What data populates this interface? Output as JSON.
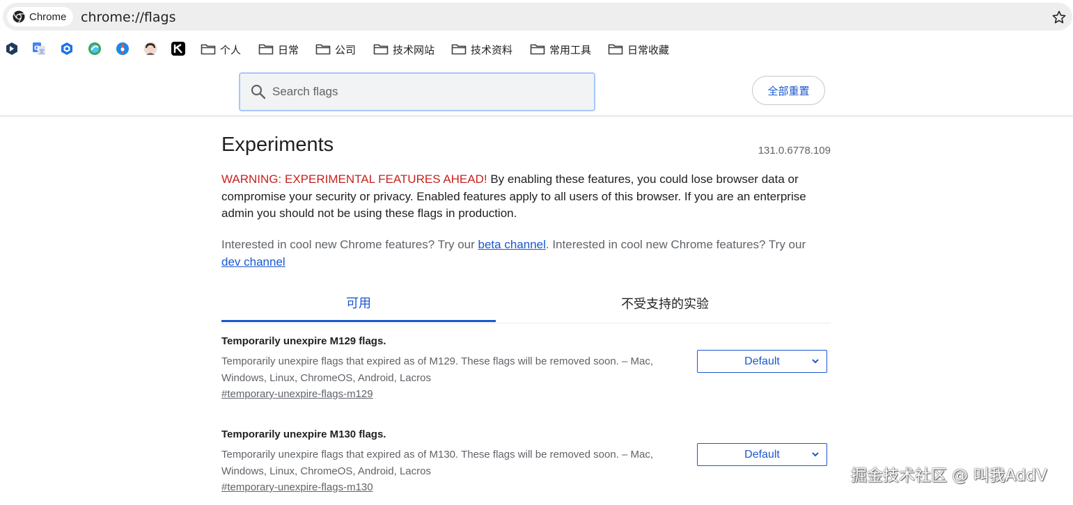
{
  "omnibox": {
    "chip_label": "Chrome",
    "url": "chrome://flags",
    "star_icon": "star-outline-icon"
  },
  "bookmarks": {
    "icons": [
      {
        "name": "bookmark-app-1-icon",
        "color": "#1f3a5c"
      },
      {
        "name": "google-translate-icon",
        "color": "#4285f4"
      },
      {
        "name": "bookmark-app-3-icon",
        "color": "#1a73e8"
      },
      {
        "name": "bookmark-app-4-icon",
        "color": "#34a853"
      },
      {
        "name": "bookmark-app-5-icon",
        "color": "#1e88e5"
      },
      {
        "name": "avatar-bookmark-icon",
        "color": "#7b5e57"
      },
      {
        "name": "bookmark-app-7-icon",
        "color": "#000000"
      }
    ],
    "folders": [
      "个人",
      "日常",
      "公司",
      "技术网站",
      "技术资料",
      "常用工具",
      "日常收藏"
    ]
  },
  "header": {
    "search_placeholder": "Search flags",
    "reset_label": "全部重置"
  },
  "main": {
    "title": "Experiments",
    "version": "131.0.6778.109",
    "warning_red": "WARNING: EXPERIMENTAL FEATURES AHEAD!",
    "warning_text": " By enabling these features, you could lose browser data or compromise your security or privacy. Enabled features apply to all users of this browser. If you are an enterprise admin you should not be using these flags in production.",
    "interest_text_1": "Interested in cool new Chrome features? Try our ",
    "beta_link": "beta channel",
    "interest_text_2": ". Interested in cool new Chrome features? Try our ",
    "dev_link": "dev channel",
    "tabs": {
      "available": "可用",
      "unavailable": "不受支持的实验"
    },
    "flags": [
      {
        "name": "Temporarily unexpire M129 flags.",
        "description": "Temporarily unexpire flags that expired as of M129. These flags will be removed soon. – Mac, Windows, Linux, ChromeOS, Android, Lacros",
        "link": "#temporary-unexpire-flags-m129",
        "value": "Default"
      },
      {
        "name": "Temporarily unexpire M130 flags.",
        "description": "Temporarily unexpire flags that expired as of M130. These flags will be removed soon. – Mac, Windows, Linux, ChromeOS, Android, Lacros",
        "link": "#temporary-unexpire-flags-m130",
        "value": "Default"
      }
    ]
  },
  "watermark": "掘金技术社区 @ 叫我AddV",
  "colors": {
    "accent": "#1a57d0",
    "warning": "#c5221f",
    "muted": "#5f6368"
  }
}
